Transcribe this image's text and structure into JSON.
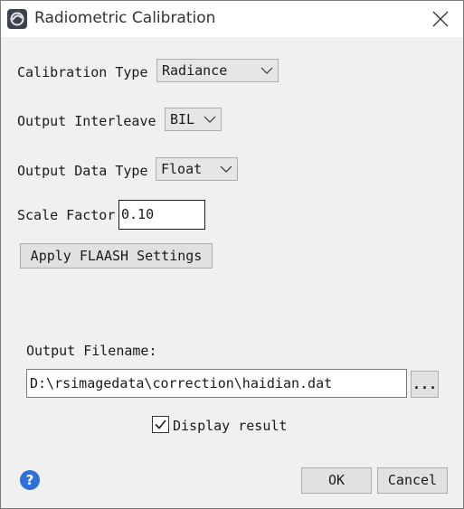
{
  "window": {
    "title": "Radiometric Calibration"
  },
  "form": {
    "calibration_type": {
      "label": "Calibration Type",
      "value": "Radiance"
    },
    "output_interleave": {
      "label": "Output Interleave",
      "value": "BIL"
    },
    "output_data_type": {
      "label": "Output Data Type",
      "value": "Float"
    },
    "scale_factor": {
      "label": "Scale Factor",
      "value": "0.10"
    },
    "apply_flaash_label": "Apply FLAASH Settings"
  },
  "output": {
    "filename_label": "Output Filename:",
    "filename_value": "D:\\rsimagedata\\correction\\haidian.dat",
    "browse_label": "...",
    "display_result_label": "Display result",
    "display_result_checked": true
  },
  "footer": {
    "help_glyph": "?",
    "ok_label": "OK",
    "cancel_label": "Cancel"
  },
  "icons": {
    "app": "envi-app-icon",
    "close": "close-icon",
    "dropdown": "chevron-down-icon",
    "check": "checkmark-icon",
    "help": "help-icon"
  },
  "colors": {
    "window_bg": "#f0f0f0",
    "titlebar_bg": "#ffffff",
    "help_blue": "#2f6fd8"
  }
}
